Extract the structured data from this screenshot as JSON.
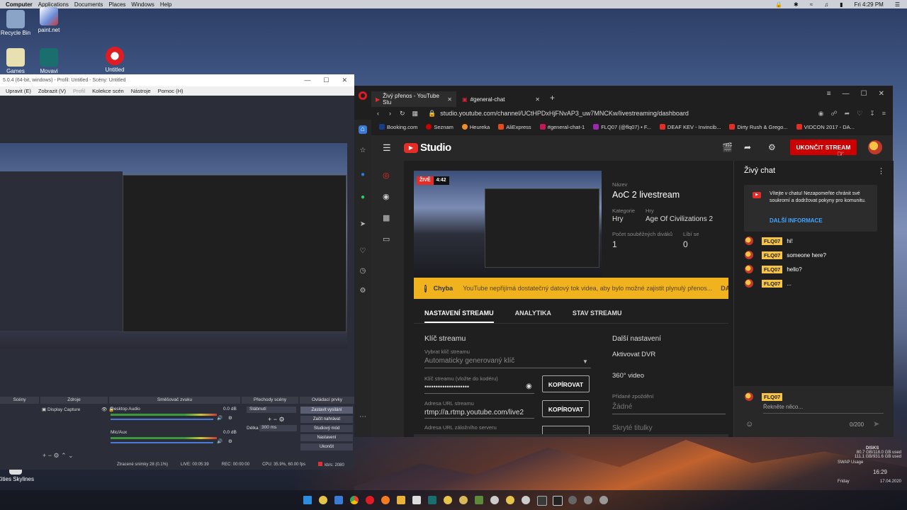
{
  "menubar": {
    "computer": "Computer",
    "applications": "Applications",
    "documents": "Documents",
    "places": "Places",
    "windows": "Windows",
    "help": "Help",
    "clock": "Fri 4:29 PM"
  },
  "desktop": {
    "icons": [
      {
        "label": "Recycle Bin"
      },
      {
        "label": "paint.net"
      },
      {
        "label": "Games"
      },
      {
        "label": "Movavi"
      },
      {
        "label": "Untitled"
      },
      {
        "label": "Cities Skylines"
      }
    ]
  },
  "obs": {
    "title": "5.0.4 (64-bit, windows) - Profil: Untitled - Scény: Untitled",
    "menu": [
      "Upravit (E)",
      "Zobrazit (V)",
      "Profil",
      "Kolekce scén",
      "Nástroje",
      "Pomoc (H)"
    ],
    "panels": {
      "scenes": "Scény",
      "sources": "Zdroje",
      "mixer": "Směšovač zvuku",
      "transitions": "Přechody scény",
      "controls": "Ovládací prvky"
    },
    "source_item": "Display Capture",
    "mixer": [
      {
        "name": "Desktop Audio",
        "db": "0.0 dB"
      },
      {
        "name": "Mic/Aux",
        "db": "0.0 dB"
      }
    ],
    "transition": {
      "type": "Slábnutí",
      "duration_label": "Délka",
      "duration": "300 ms"
    },
    "controls": [
      "Zastavit vysílání",
      "Začít nahrávat",
      "Studiový mód",
      "Nastavení",
      "Ukončit"
    ],
    "status": {
      "dropped": "Ztracené snímky 28 (0.1%)",
      "live": "LIVE: 00:05:39",
      "rec": "REC: 00:00:00",
      "cpu": "CPU: 35.9%, 60.00 fps",
      "kbps": "kb/s: 2080"
    }
  },
  "browser": {
    "tabs": [
      {
        "label": "Živý přenos - YouTube Stu"
      },
      {
        "label": "#general-chat"
      }
    ],
    "url": "studio.youtube.com/channel/UCtHPDxHjFNvAP3_uw7MNCKw/livestreaming/dashboard",
    "bookmarks": [
      "Booking.com",
      "Seznam",
      "Heureka",
      "AliExpress",
      "#general-chat-1",
      "FLQ07 (@flq07) • F...",
      "DEAF KEV - Invincib...",
      "Dirty Rush & Grego...",
      "VIDCON 2017 - DA..."
    ]
  },
  "studio": {
    "logo": "Studio",
    "end_stream": "UKONČIT STREAM",
    "live_label": "ŽIVĚ",
    "live_time": "4:42",
    "title_label": "Název",
    "title": "AoC 2 livestream",
    "category_label": "Kategorie",
    "category": "Hry",
    "game_label": "Hry",
    "game": "Age Of Civilizations 2",
    "viewers_label": "Počet souběžných diváků",
    "viewers": "1",
    "likes_label": "Líbí se",
    "likes": "0",
    "warning_title": "Chyba",
    "warning_text": "YouTube nepřijímá dostatečný datový tok videa, aby bylo možné zajistit plynulý přenos...",
    "warning_action": "DA",
    "tabs": [
      "NASTAVENÍ STREAMU",
      "ANALYTIKA",
      "STAV STREAMU"
    ],
    "stream_key_heading": "Klíč streamu",
    "select_key_label": "Vybrat klíč streamu",
    "select_key_value": "Automaticky generovaný klíč",
    "key_label": "Klíč streamu (vložte do kodéru)",
    "key_value": "••••••••••••••••••••",
    "copy": "KOPÍROVAT",
    "url_label": "Adresa URL streamu",
    "url_value": "rtmp://a.rtmp.youtube.com/live2",
    "backup_label": "Adresa URL záložního serveru",
    "more_heading": "Další nastavení",
    "dvr": "Aktivovat DVR",
    "video360": "360° video",
    "delay_label": "Přidané zpoždění",
    "delay_value": "Žádné",
    "subtitles": "Skryté titulky"
  },
  "chat": {
    "title": "Živý chat",
    "notice": "Vítejte v chatu! Nezapomeňte chránit své soukromí a dodržovat pokyny pro komunitu.",
    "notice_link": "DALŠÍ INFORMACE",
    "messages": [
      {
        "user": "FLQ07",
        "text": "hi!"
      },
      {
        "user": "FLQ07",
        "text": "someone here?"
      },
      {
        "user": "FLQ07",
        "text": "hello?"
      },
      {
        "user": "FLQ07",
        "text": "..."
      }
    ],
    "input_user": "FLQ07",
    "input_placeholder": "Řekněte něco...",
    "counter": "0/200"
  },
  "sysmon": {
    "disks": "DISKS",
    "c_drive": "80.7 GB/118.0 GB used",
    "d_drive": "111.1 GB/931.6 GB used",
    "swap": "SWAP Usage",
    "time": "16:29",
    "day": "Friday",
    "date": "17.04.2020"
  }
}
